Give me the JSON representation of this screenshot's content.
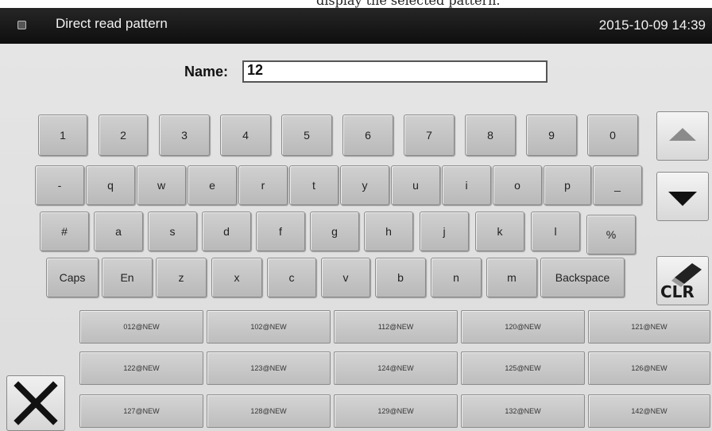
{
  "caption": "display the selected pattern.",
  "titlebar": {
    "title": "Direct read pattern",
    "datetime": "2015-10-09 14:39"
  },
  "name_field": {
    "label": "Name:",
    "value": "12"
  },
  "keyboard": {
    "row1": [
      "1",
      "2",
      "3",
      "4",
      "5",
      "6",
      "7",
      "8",
      "9",
      "0"
    ],
    "row2": [
      "-",
      "q",
      "w",
      "e",
      "r",
      "t",
      "y",
      "u",
      "i",
      "o",
      "p",
      "_"
    ],
    "row3": [
      "#",
      "a",
      "s",
      "d",
      "f",
      "g",
      "h",
      "j",
      "k",
      "l",
      "%"
    ],
    "row4": [
      "Caps",
      "En",
      "z",
      "x",
      "c",
      "v",
      "b",
      "n",
      "m",
      "Backspace"
    ]
  },
  "side_buttons": {
    "clear_label": "CLR"
  },
  "patterns": [
    [
      "012@NEW",
      "102@NEW",
      "112@NEW",
      "120@NEW",
      "121@NEW"
    ],
    [
      "122@NEW",
      "123@NEW",
      "124@NEW",
      "125@NEW",
      "126@NEW"
    ],
    [
      "127@NEW",
      "128@NEW",
      "129@NEW",
      "132@NEW",
      "142@NEW"
    ]
  ]
}
